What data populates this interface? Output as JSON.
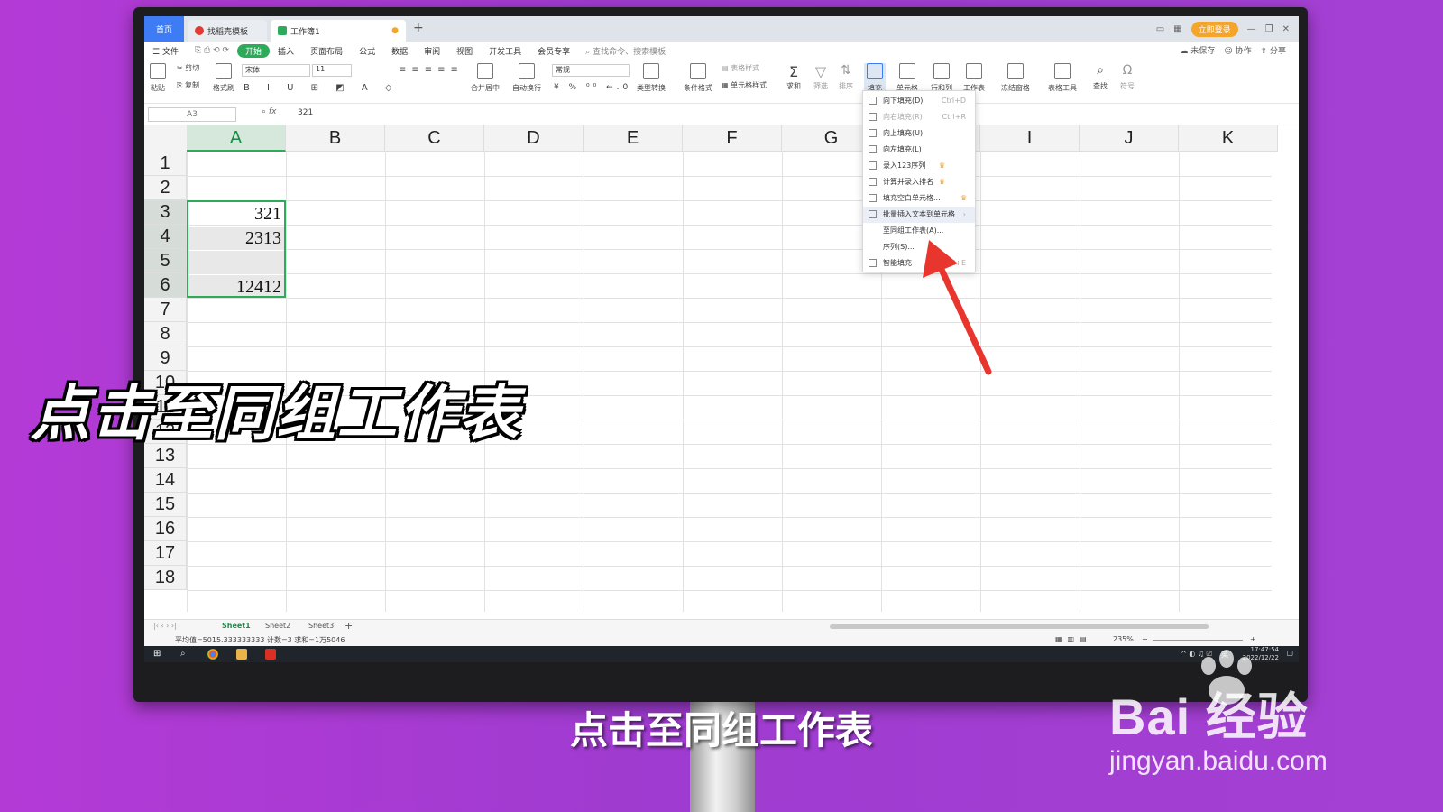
{
  "titlebar": {
    "home_tab": "首页",
    "tab1": "找稻壳模板",
    "tab2": "工作簿1",
    "login": "立即登录"
  },
  "menu": {
    "file": "文件",
    "items": [
      "开始",
      "插入",
      "页面布局",
      "公式",
      "数据",
      "审阅",
      "视图",
      "开发工具",
      "会员专享"
    ],
    "search": "查找命令、搜索模板",
    "unsaved": "未保存",
    "collab": "协作",
    "share": "分享"
  },
  "ribbon": {
    "paste": "粘贴",
    "cut": "剪切",
    "copy": "复制",
    "format_painter": "格式刷",
    "font_name": "宋体",
    "font_size": "11",
    "merge": "合并居中",
    "wrap": "自动换行",
    "number_format": "常规",
    "type_convert": "类型转换",
    "cond_format": "条件格式",
    "table_style": "表格样式",
    "cell_style": "单元格样式",
    "sum": "求和",
    "filter": "筛选",
    "sort": "排序",
    "fill": "填充",
    "cell": "单元格",
    "rowcol": "行和列",
    "sheet": "工作表",
    "freeze": "冻结窗格",
    "table_tools": "表格工具",
    "find": "查找",
    "symbol": "符号"
  },
  "formula_bar": {
    "name_box": "A3",
    "fx": "fx",
    "value": "321"
  },
  "grid": {
    "columns": [
      "A",
      "B",
      "C",
      "D",
      "E",
      "F",
      "G",
      "H",
      "I",
      "J",
      "K"
    ],
    "rows": [
      "1",
      "2",
      "3",
      "4",
      "5",
      "6",
      "7",
      "8",
      "9",
      "10",
      "11",
      "12",
      "13",
      "14",
      "15",
      "16",
      "17",
      "18"
    ],
    "cells": {
      "A3": "321",
      "A4": "2313",
      "A5": "",
      "A6": "12412"
    }
  },
  "fill_menu": {
    "items": [
      {
        "label": "向下填充(D)",
        "shortcut": "Ctrl+D",
        "disabled": false,
        "vip": false
      },
      {
        "label": "向右填充(R)",
        "shortcut": "Ctrl+R",
        "disabled": true,
        "vip": false
      },
      {
        "label": "向上填充(U)",
        "shortcut": "",
        "disabled": false,
        "vip": false
      },
      {
        "label": "向左填充(L)",
        "shortcut": "",
        "disabled": false,
        "vip": false
      },
      {
        "label": "录入123序列",
        "shortcut": "",
        "disabled": false,
        "vip": true
      },
      {
        "label": "计算并录入排名",
        "shortcut": "",
        "disabled": false,
        "vip": true
      },
      {
        "label": "填充空白单元格...",
        "shortcut": "",
        "disabled": false,
        "vip": true
      },
      {
        "label": "批量插入文本到单元格",
        "shortcut": "›",
        "disabled": false,
        "vip": false
      },
      {
        "label": "至同组工作表(A)...",
        "shortcut": "",
        "disabled": false,
        "vip": false
      },
      {
        "label": "序列(S)...",
        "shortcut": "",
        "disabled": false,
        "vip": false
      },
      {
        "label": "智能填充",
        "shortcut": "Ctrl+E",
        "disabled": false,
        "vip": false
      }
    ]
  },
  "sheets": [
    "Sheet1",
    "Sheet2",
    "Sheet3"
  ],
  "status": {
    "stats": "平均值=5015.333333333  计数=3  求和=1万5046",
    "zoom": "235%"
  },
  "taskbar": {
    "time": "17:47:54",
    "date": "2022/12/22",
    "ime": "英"
  },
  "overlay": {
    "caption": "点击至同组工作表",
    "subtitle": "点击至同组工作表",
    "watermark_brand": "Bai  经验",
    "watermark_url": "jingyan.baidu.com"
  },
  "colors": {
    "background": "#a93cd3",
    "accent_green": "#2eaa5b",
    "arrow_red": "#e8362f",
    "wps_blue": "#3d7cf5"
  }
}
